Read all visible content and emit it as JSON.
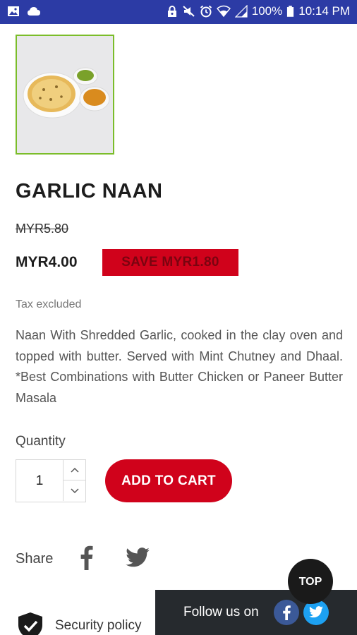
{
  "status_bar": {
    "battery": "100%",
    "time": "10:14 PM",
    "icons": [
      "image-icon",
      "cloud-icon",
      "lock-icon",
      "mute-icon",
      "alarm-icon",
      "wifi-icon",
      "signal-icon",
      "battery-icon"
    ]
  },
  "product": {
    "title": "GARLIC NAAN",
    "old_price": "MYR5.80",
    "price": "MYR4.00",
    "save_badge": "SAVE MYR1.80",
    "tax_note": "Tax excluded",
    "description": "Naan With Shredded Garlic, cooked in the clay oven and topped with butter. Served with Mint Chutney and Dhaal. *Best Combinations with Butter Chicken or Paneer Butter Masala"
  },
  "purchase": {
    "quantity_label": "Quantity",
    "quantity_value": "1",
    "add_to_cart_label": "ADD TO CART"
  },
  "share": {
    "label": "Share"
  },
  "floating": {
    "top_label": "TOP",
    "follow_label": "Follow us on"
  },
  "footer": {
    "security_label": "Security policy"
  },
  "colors": {
    "status_bar": "#2c3ba5",
    "accent_red": "#d0021b",
    "thumb_border": "#7bbd2a",
    "follow_bar": "#262a2e",
    "facebook": "#3b5998",
    "twitter": "#1da1f2"
  }
}
